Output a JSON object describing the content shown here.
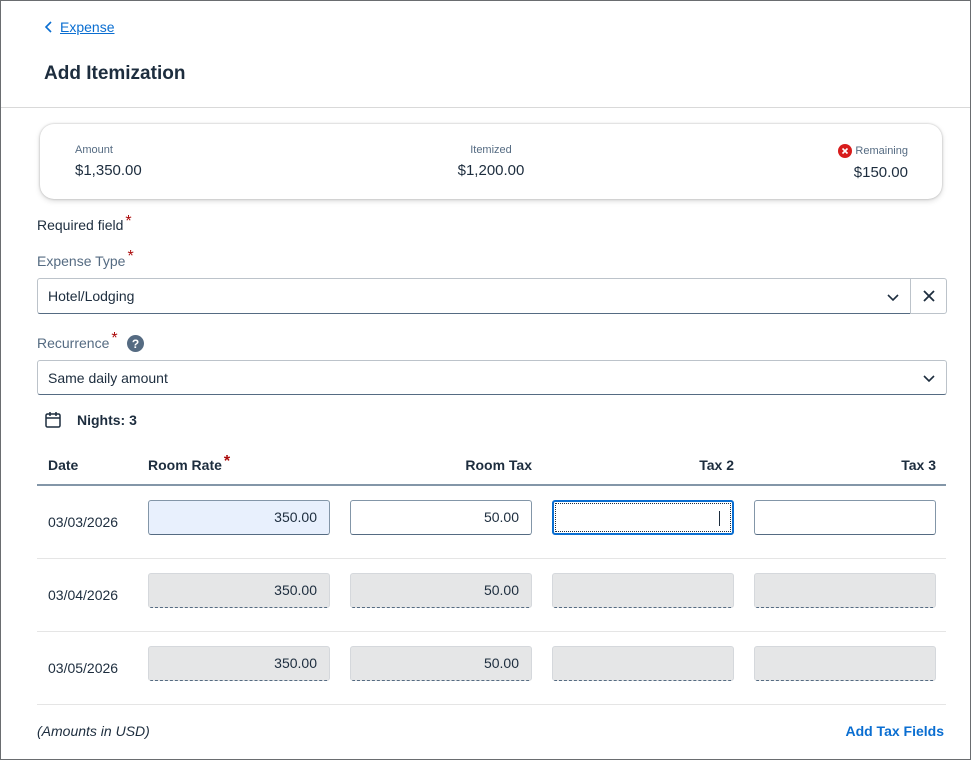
{
  "header": {
    "back_label": "Expense",
    "title": "Add Itemization"
  },
  "summary": {
    "amount_label": "Amount",
    "amount_value": "$1,350.00",
    "itemized_label": "Itemized",
    "itemized_value": "$1,200.00",
    "remaining_label": "Remaining",
    "remaining_value": "$150.00"
  },
  "form": {
    "required_note": "Required field",
    "required_marker": "*",
    "expense_type_label": "Expense Type",
    "expense_type_value": "Hotel/Lodging",
    "recurrence_label": "Recurrence",
    "recurrence_value": "Same daily amount"
  },
  "nights_label": "Nights: 3",
  "table": {
    "headers": [
      "Date",
      "Room Rate",
      "Room Tax",
      "Tax 2",
      "Tax 3"
    ],
    "rows": [
      {
        "date": "03/03/2026",
        "room_rate": "350.00",
        "room_tax": "50.00",
        "tax2": "",
        "tax3": ""
      },
      {
        "date": "03/04/2026",
        "room_rate": "350.00",
        "room_tax": "50.00",
        "tax2": "",
        "tax3": ""
      },
      {
        "date": "03/05/2026",
        "room_rate": "350.00",
        "room_tax": "50.00",
        "tax2": "",
        "tax3": ""
      }
    ]
  },
  "footer": {
    "note": "(Amounts in USD)",
    "add_tax_label": "Add Tax Fields"
  },
  "colors": {
    "accent": "#0a6ed1",
    "required": "#aa0808",
    "error": "#d81c1c",
    "text": "#1d2d3e"
  },
  "icons": [
    "chevron-left-icon",
    "error-icon",
    "chevron-down-icon",
    "close-icon",
    "help-icon",
    "calendar-icon"
  ]
}
